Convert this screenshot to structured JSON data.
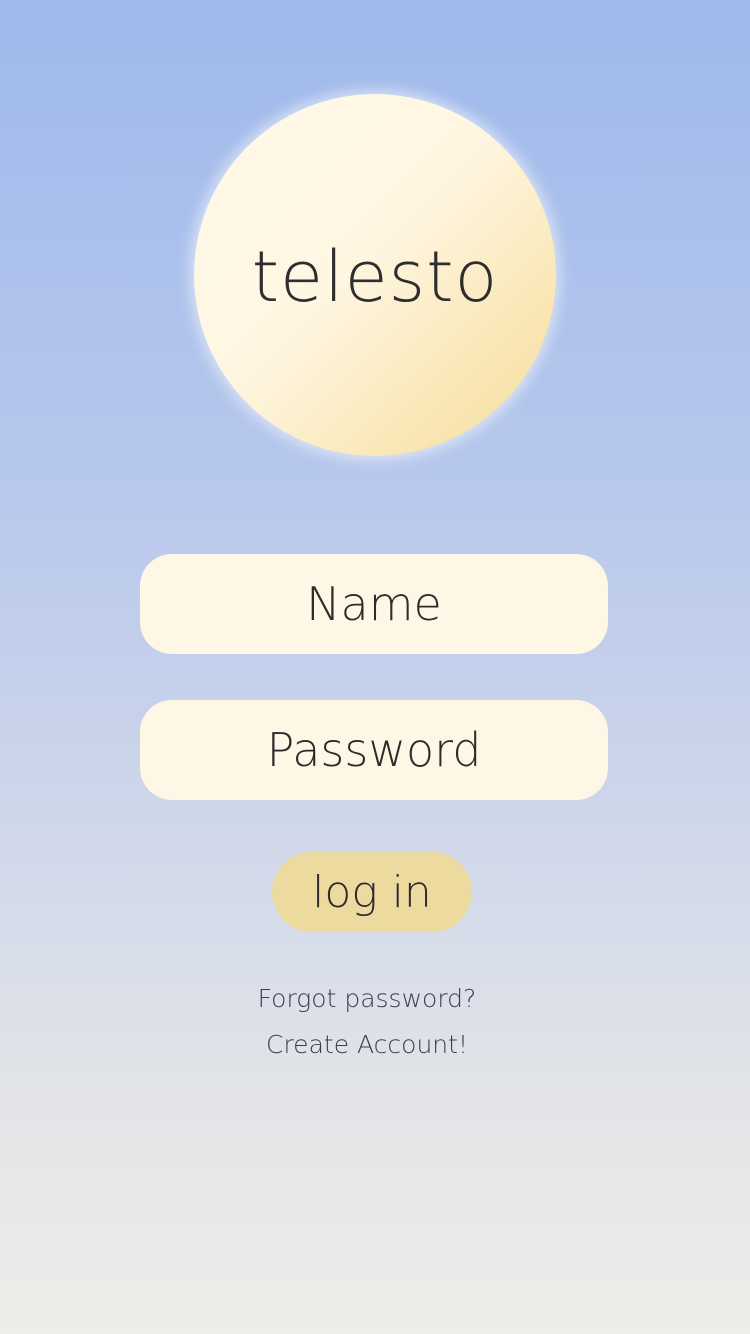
{
  "logo": {
    "text": "telesto"
  },
  "form": {
    "name_placeholder": "Name",
    "password_placeholder": "Password",
    "login_label": "log in"
  },
  "links": {
    "forgot_password": "Forgot password?",
    "create_account": "Create Account!"
  },
  "colors": {
    "background_top": "#9fb9eb",
    "background_bottom": "#eeede9",
    "field_fill": "#fff7e6",
    "button_fill": "#ecda9e",
    "logo_gradient_light": "#fff9ea",
    "logo_gradient_dark": "#f5dc9c"
  }
}
